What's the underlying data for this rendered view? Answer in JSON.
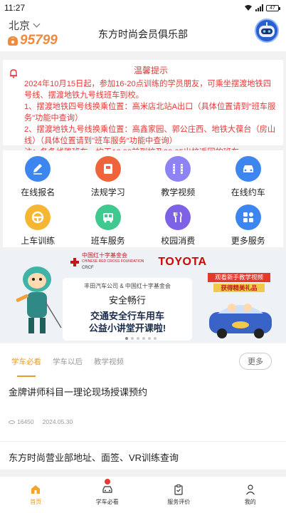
{
  "status": {
    "time": "11:27",
    "battery": "47"
  },
  "header": {
    "city": "北京",
    "hotline": "95799",
    "title": "东方时尚会员俱乐部"
  },
  "notice": {
    "title": "温馨提示",
    "lines": [
      "2024年10月15日起，参加16-20点训练的学员朋友，可乘坐摆渡地铁四号线、摆渡地铁九号线班车到校。",
      "1、摆渡地铁四号线换乘位置：高米店北站A出口（具体位置请到\"班车服务\"功能中查询）",
      "2、摆渡地铁九号线换乘位置：高鑫家园、郭公庄西、地铁大葆台（房山线）（具体位置请到\"班车服务\"功能中查询）",
      "注：各条线路班车，均无16:00前到校及20:05出校返回的班车。"
    ],
    "color": "#e23b3b"
  },
  "grid": {
    "items": [
      {
        "label": "在线报名",
        "icon": "pencil-icon",
        "color": "#3d86f0"
      },
      {
        "label": "法规学习",
        "icon": "book-icon",
        "color": "#f0643c"
      },
      {
        "label": "教学视频",
        "icon": "film-icon",
        "color": "#8e83f5"
      },
      {
        "label": "在线约车",
        "icon": "car-icon",
        "color": "#3d86f0"
      },
      {
        "label": "上车训练",
        "icon": "steering-wheel-icon",
        "color": "#f5b733"
      },
      {
        "label": "班车服务",
        "icon": "bus-icon",
        "color": "#3fc88f"
      },
      {
        "label": "校园消费",
        "icon": "fork-knife-icon",
        "color": "#7e62e6"
      },
      {
        "label": "更多服务",
        "icon": "apps-grid-icon",
        "color": "#3d86f0"
      }
    ]
  },
  "banner": {
    "redcross_cn": "中国红十字基金会",
    "redcross_en": "CHINESE RED CROSS FOUNDATION",
    "redcross_abbr": "CRCF",
    "brand": "TOYOTA",
    "card_sub": "丰田汽车公司 & 中国红十字基金会",
    "card_title": "安全畅行",
    "card_main1": "交通安全行车用车",
    "card_main2": "公益小讲堂开课啦!",
    "promo_top": "观看新手教学视频",
    "promo_bottom": "获得精美礼品"
  },
  "content_tabs": {
    "tabs": [
      "学车必看",
      "学车以后",
      "教学视频"
    ],
    "active_index": 0,
    "more": "更多"
  },
  "articles": [
    {
      "title": "金牌讲师科目一理论现场授课预约",
      "views": "16450",
      "date": "2024.05.30"
    },
    {
      "title": "东方时尚营业部地址、面签、VR训练查询"
    }
  ],
  "tabbar": {
    "items": [
      {
        "label": "首页",
        "icon": "home-icon"
      },
      {
        "label": "学车必看",
        "icon": "car-icon"
      },
      {
        "label": "服务评价",
        "icon": "clipboard-icon"
      },
      {
        "label": "我的",
        "icon": "person-icon"
      }
    ],
    "active_index": 0,
    "accent": "#e89a2b"
  }
}
